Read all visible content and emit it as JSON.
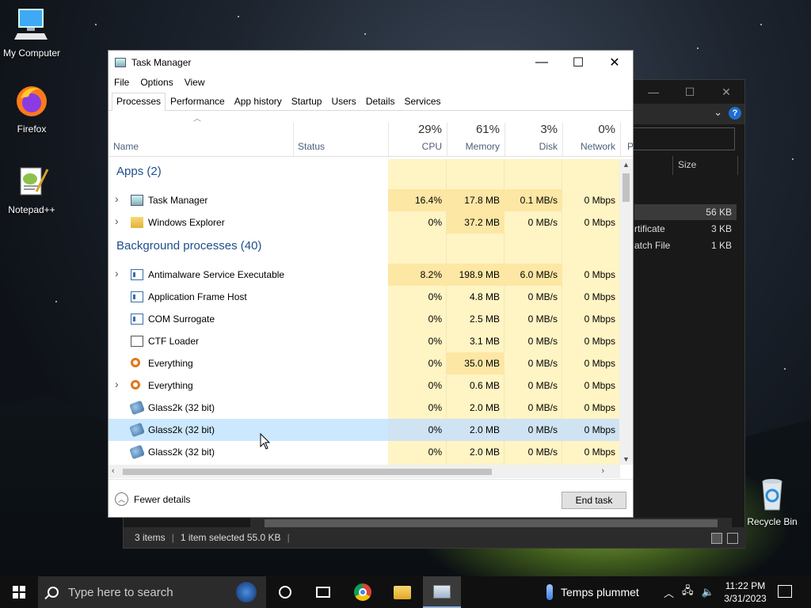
{
  "desktop": {
    "icons": [
      {
        "label": "My Computer",
        "icon": "computer-icon"
      },
      {
        "label": "Firefox",
        "icon": "firefox-icon"
      },
      {
        "label": "Notepad++",
        "icon": "notepad-plus-plus-icon"
      },
      {
        "label": "Recycle Bin",
        "icon": "recycle-bin-icon"
      }
    ]
  },
  "explorer": {
    "column_size": "Size",
    "files": [
      {
        "name": "",
        "size": "56 KB",
        "selected": true
      },
      {
        "name": "rtificate",
        "size": "3 KB"
      },
      {
        "name": "atch File",
        "size": "1 KB"
      }
    ],
    "status": {
      "items": "3 items",
      "selected": "1 item selected  55.0 KB",
      "sep": "|"
    }
  },
  "taskmanager": {
    "title": "Task Manager",
    "window_buttons": {
      "minimize": "—",
      "maximize": "☐",
      "close": "✕"
    },
    "menu": [
      "File",
      "Options",
      "View"
    ],
    "tabs": [
      "Processes",
      "Performance",
      "App history",
      "Startup",
      "Users",
      "Details",
      "Services"
    ],
    "active_tab": "Processes",
    "columns": {
      "name": "Name",
      "status": "Status",
      "cpu": {
        "label": "CPU",
        "pct": "29%"
      },
      "memory": {
        "label": "Memory",
        "pct": "61%"
      },
      "disk": {
        "label": "Disk",
        "pct": "3%"
      },
      "network": {
        "label": "Network",
        "pct": "0%"
      },
      "power": "P"
    },
    "groups": {
      "apps": "Apps (2)",
      "background": "Background processes (40)"
    },
    "processes": [
      {
        "name": "Task Manager",
        "icon": "task-manager-icon",
        "expand": true,
        "cpu": "16.4%",
        "memory": "17.8 MB",
        "disk": "0.1 MB/s",
        "network": "0 Mbps"
      },
      {
        "name": "Windows Explorer",
        "icon": "folder-icon",
        "expand": true,
        "cpu": "0%",
        "memory": "37.2 MB",
        "disk": "0 MB/s",
        "network": "0 Mbps"
      },
      {
        "name": "Antimalware Service Executable",
        "icon": "app-icon",
        "expand": true,
        "cpu": "8.2%",
        "memory": "198.9 MB",
        "disk": "6.0 MB/s",
        "network": "0 Mbps"
      },
      {
        "name": "Application Frame Host",
        "icon": "app-icon",
        "expand": false,
        "cpu": "0%",
        "memory": "4.8 MB",
        "disk": "0 MB/s",
        "network": "0 Mbps"
      },
      {
        "name": "COM Surrogate",
        "icon": "app-icon",
        "expand": false,
        "cpu": "0%",
        "memory": "2.5 MB",
        "disk": "0 MB/s",
        "network": "0 Mbps"
      },
      {
        "name": "CTF Loader",
        "icon": "ctf-icon",
        "expand": false,
        "cpu": "0%",
        "memory": "3.1 MB",
        "disk": "0 MB/s",
        "network": "0 Mbps"
      },
      {
        "name": "Everything",
        "icon": "everything-icon",
        "expand": false,
        "cpu": "0%",
        "memory": "35.0 MB",
        "disk": "0 MB/s",
        "network": "0 Mbps"
      },
      {
        "name": "Everything",
        "icon": "everything-icon",
        "expand": true,
        "cpu": "0%",
        "memory": "0.6 MB",
        "disk": "0 MB/s",
        "network": "0 Mbps"
      },
      {
        "name": "Glass2k (32 bit)",
        "icon": "glass2k-icon",
        "expand": false,
        "cpu": "0%",
        "memory": "2.0 MB",
        "disk": "0 MB/s",
        "network": "0 Mbps"
      },
      {
        "name": "Glass2k (32 bit)",
        "icon": "glass2k-icon",
        "expand": false,
        "cpu": "0%",
        "memory": "2.0 MB",
        "disk": "0 MB/s",
        "network": "0 Mbps",
        "selected": true
      },
      {
        "name": "Glass2k (32 bit)",
        "icon": "glass2k-icon",
        "expand": false,
        "cpu": "0%",
        "memory": "2.0 MB",
        "disk": "0 MB/s",
        "network": "0 Mbps"
      }
    ],
    "footer": {
      "fewer_details": "Fewer details",
      "end_task": "End task"
    },
    "colors": {
      "heat_high": "#fde7a4",
      "heat_low": "#fff4c4",
      "selected": "#cce8ff",
      "group_title": "#1e4e8c"
    }
  },
  "taskbar": {
    "search_placeholder": "Type here to search",
    "weather": "Temps plummet",
    "time": "11:22 PM",
    "date": "3/31/2023",
    "tray_chevron": "︿"
  }
}
